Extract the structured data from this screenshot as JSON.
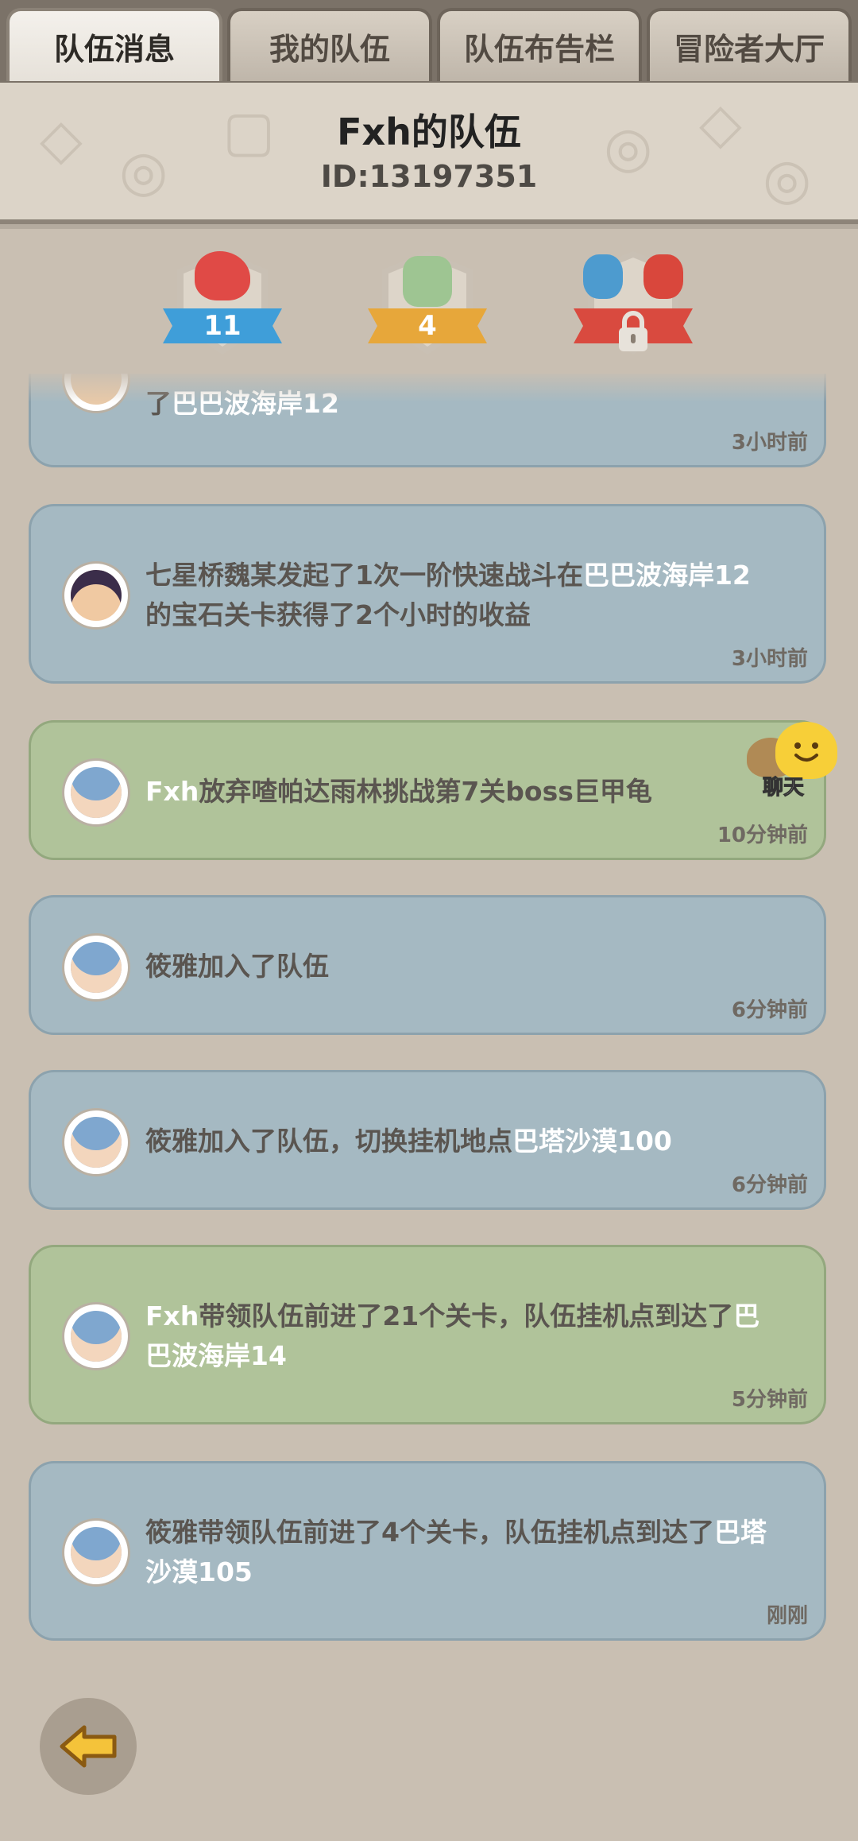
{
  "tabs": [
    "队伍消息",
    "我的队伍",
    "队伍布告栏",
    "冒险者大厅"
  ],
  "header": {
    "team_name": "Fxh的队伍",
    "team_id": "ID:13197351"
  },
  "badges": [
    {
      "label": "11",
      "color": "#3f9ed9"
    },
    {
      "label": "4",
      "color": "#e7a73a"
    },
    {
      "label": "",
      "locked": true,
      "color": "#d94a3f"
    }
  ],
  "feed": [
    {
      "parts": [
        "了",
        "巴巴波海岸12"
      ],
      "time": "3小时前"
    },
    {
      "parts": [
        "七星桥魏某发起了1次一阶快速战斗在",
        "巴巴波海岸12",
        "的宝石关卡获得了2个小时的收益"
      ],
      "time": "3小时前"
    },
    {
      "parts": [
        "Fxh",
        "放弃喳帕达雨林挑战第7关boss巨甲龟"
      ],
      "time": "10分钟前"
    },
    {
      "parts": [
        "筱雅加入了队伍"
      ],
      "time": "6分钟前"
    },
    {
      "parts": [
        "筱雅加入了队伍，切换挂机地点",
        "巴塔沙漠100"
      ],
      "time": "6分钟前"
    },
    {
      "parts": [
        "Fxh",
        "带领队伍前进了21个关卡，队伍挂机点到达了",
        "巴巴波海岸14"
      ],
      "time": "5分钟前"
    },
    {
      "parts": [
        "筱雅带领队伍前进了4个关卡，队伍挂机点到达了",
        "巴塔沙漠105"
      ],
      "time": "刚刚"
    }
  ],
  "chat": {
    "label": "聊天"
  }
}
